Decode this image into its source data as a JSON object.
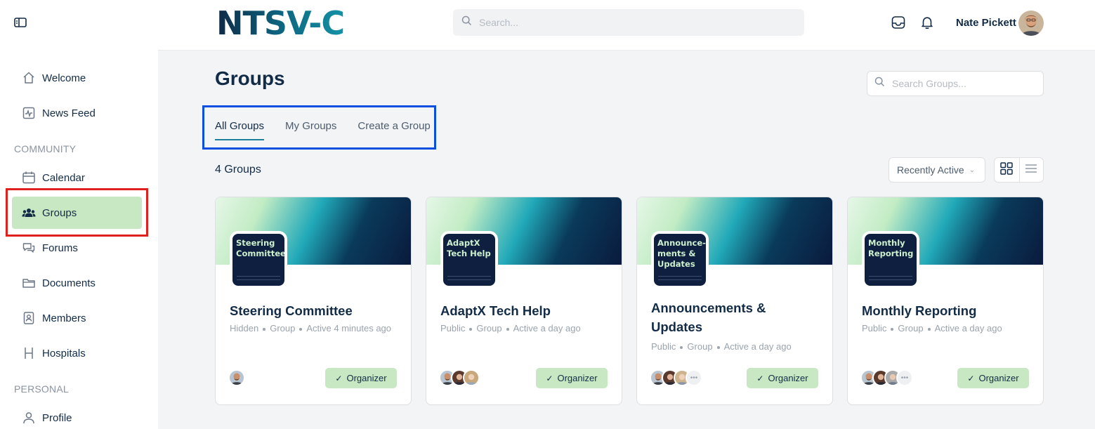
{
  "app": {
    "logo": "NTSV-C"
  },
  "header": {
    "search_placeholder": "Search...",
    "user_name": "Nate Pickett"
  },
  "sidebar": {
    "items": [
      {
        "label": "Welcome",
        "icon": "home-icon"
      },
      {
        "label": "News Feed",
        "icon": "activity-icon"
      }
    ],
    "community_label": "COMMUNITY",
    "community_items": [
      {
        "label": "Calendar",
        "icon": "calendar-icon"
      },
      {
        "label": "Groups",
        "icon": "users-icon",
        "active": true
      },
      {
        "label": "Forums",
        "icon": "chat-icon"
      },
      {
        "label": "Documents",
        "icon": "folder-icon"
      },
      {
        "label": "Members",
        "icon": "id-card-icon"
      },
      {
        "label": "Hospitals",
        "icon": "hospital-icon"
      }
    ],
    "personal_label": "PERSONAL",
    "personal_items": [
      {
        "label": "Profile",
        "icon": "user-icon"
      }
    ]
  },
  "main": {
    "title": "Groups",
    "search_placeholder": "Search Groups...",
    "tabs": [
      {
        "label": "All Groups",
        "active": true
      },
      {
        "label": "My Groups"
      },
      {
        "label": "Create a Group"
      }
    ],
    "count_label": "4 Groups",
    "sort": {
      "selected": "Recently Active"
    },
    "view_modes": [
      "grid-icon",
      "list-icon"
    ],
    "groups": [
      {
        "badge": "Steering Committee",
        "title": "Steering Committee",
        "privacy": "Hidden",
        "type": "Group",
        "activity": "Active 4 minutes ago",
        "role": "Organizer",
        "members_shown": 1,
        "has_more": false
      },
      {
        "badge": "AdaptX Tech Help",
        "title": "AdaptX Tech Help",
        "privacy": "Public",
        "type": "Group",
        "activity": "Active a day ago",
        "role": "Organizer",
        "members_shown": 3,
        "has_more": false
      },
      {
        "badge": "Announce-ments & Updates",
        "title": "Announcements & Updates",
        "privacy": "Public",
        "type": "Group",
        "activity": "Active a day ago",
        "role": "Organizer",
        "members_shown": 3,
        "has_more": true
      },
      {
        "badge": "Monthly Reporting",
        "title": "Monthly Reporting",
        "privacy": "Public",
        "type": "Group",
        "activity": "Active a day ago",
        "role": "Organizer",
        "members_shown": 3,
        "has_more": true
      }
    ]
  },
  "colors": {
    "accent": "#1e7f9a",
    "active_bg": "#c8e8c3",
    "title": "#122b46"
  }
}
